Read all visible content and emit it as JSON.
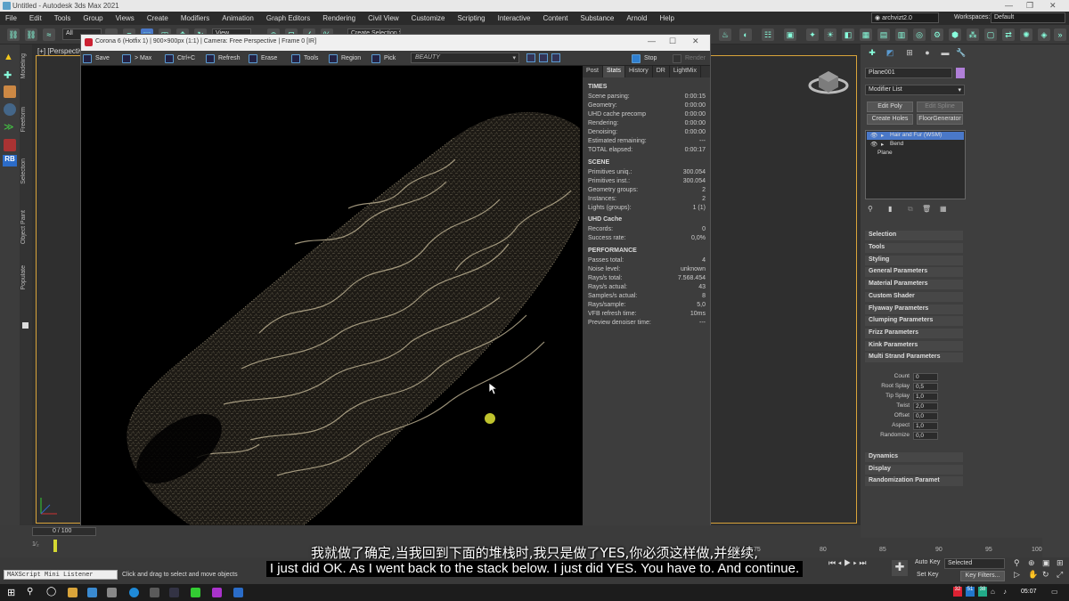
{
  "app": {
    "title": "Untitled - Autodesk 3ds Max 2021"
  },
  "menu": [
    "File",
    "Edit",
    "Tools",
    "Group",
    "Views",
    "Create",
    "Modifiers",
    "Animation",
    "Graph Editors",
    "Rendering",
    "Civil View",
    "Customize",
    "Scripting",
    "Interactive",
    "Content",
    "Substance",
    "Arnold",
    "Help"
  ],
  "account": {
    "user": "archvizt2.0",
    "workspaces_label": "Workspaces:",
    "workspace": "Default"
  },
  "toolbar": {
    "filter": "All",
    "view": "View",
    "selection_set": "Create Selection Se"
  },
  "left_tabs": [
    "Modeling",
    "Freeform",
    "Selection",
    "Object Paint",
    "Populate"
  ],
  "viewport": {
    "label": "[+] [Perspective"
  },
  "vfb": {
    "title": "Corona 6 (Hotfix 1) | 900×900px (1:1) | Camera: Free Perspective | Frame 0 [IR]",
    "tools": [
      "Save",
      "> Max",
      "Ctrl+C",
      "Refresh",
      "Erase",
      "Tools",
      "Region",
      "Pick"
    ],
    "pass": "BEAUTY",
    "stop_label": "Stop",
    "render_label": "Render",
    "tabs": [
      "Post",
      "Stats",
      "History",
      "DR",
      "LightMix"
    ],
    "stats": {
      "times_head": "TIMES",
      "times": [
        {
          "k": "Scene parsing:",
          "v": "0:00:15"
        },
        {
          "k": "Geometry:",
          "v": "0:00:00"
        },
        {
          "k": "UHD cache precomp",
          "v": "0:00:00"
        },
        {
          "k": "Rendering:",
          "v": "0:00:00"
        },
        {
          "k": "Denoising:",
          "v": "0:00:00"
        },
        {
          "k": "Estimated remaining:",
          "v": "---"
        },
        {
          "k": "TOTAL elapsed:",
          "v": "0:00:17"
        }
      ],
      "scene_head": "SCENE",
      "scene": [
        {
          "k": "Primitives uniq.:",
          "v": "300.054"
        },
        {
          "k": "Primitives inst.:",
          "v": "300.054"
        },
        {
          "k": "Geometry groups:",
          "v": "2"
        },
        {
          "k": "Instances:",
          "v": "2"
        },
        {
          "k": "Lights (groups):",
          "v": "1 (1)"
        }
      ],
      "uhd_head": "UHD Cache",
      "uhd": [
        {
          "k": "Records:",
          "v": "0"
        },
        {
          "k": "Success rate:",
          "v": "0,0%"
        }
      ],
      "perf_head": "PERFORMANCE",
      "perf": [
        {
          "k": "Passes total:",
          "v": "4"
        },
        {
          "k": "Noise level:",
          "v": "unknown"
        },
        {
          "k": "Rays/s total:",
          "v": "7.568.454"
        },
        {
          "k": "Rays/s actual:",
          "v": "43"
        },
        {
          "k": "Samples/s actual:",
          "v": "8"
        },
        {
          "k": "Rays/sample:",
          "v": "5,0"
        },
        {
          "k": "VFB refresh time:",
          "v": "10ms"
        },
        {
          "k": "Preview denoiser time:",
          "v": "---"
        }
      ]
    }
  },
  "command_panel": {
    "object_name": "Plane001",
    "modifier_list": "Modifier List",
    "buttons": [
      "Edit Poly",
      "Edit Spline",
      "Create Holes",
      "FloorGenerator"
    ],
    "stack": [
      "Hair and Fur (WSM)",
      "Bend",
      "Plane"
    ],
    "rollouts": [
      "Selection",
      "Tools",
      "Styling",
      "General Parameters",
      "Material Parameters",
      "Custom Shader",
      "Flyaway Parameters",
      "Clumping Parameters",
      "Frizz Parameters",
      "Kink Parameters",
      "Multi Strand Parameters"
    ],
    "multi_strand": [
      {
        "k": "Count",
        "v": "0"
      },
      {
        "k": "Root Splay",
        "v": "0,5"
      },
      {
        "k": "Tip Splay",
        "v": "1,0"
      },
      {
        "k": "Twist",
        "v": "2,0"
      },
      {
        "k": "Offset",
        "v": "0,0"
      },
      {
        "k": "Aspect",
        "v": "1,0"
      },
      {
        "k": "Randomize",
        "v": "0,0"
      }
    ],
    "rollouts_bottom": [
      "Dynamics",
      "Display",
      "Randomization Paramet"
    ]
  },
  "timeline": {
    "frame": "0 / 100",
    "ticks": [
      "75",
      "80",
      "85",
      "90",
      "95",
      "100"
    ]
  },
  "bottom": {
    "listener": "MAXScript Mini Listener",
    "status": "Click and drag to select and move objects",
    "auto_key": "Auto Key",
    "set_key": "Set Key",
    "selected": "Selected",
    "key_filters": "Key Filters..."
  },
  "subtitles": {
    "zh": "我就做了确定,当我回到下面的堆栈时,我只是做了YES,你必须这样做,并继续,",
    "en": "I just did OK. As I went back to the stack below. I just did YES. You have to. And continue."
  },
  "taskbar": {
    "time": "05:07",
    "badge1": "32",
    "badge2": "51",
    "badge3": "38"
  },
  "colors": {
    "accent": "#5a9ad0",
    "selection": "#4a78c8",
    "viewport_border": "#d9a43a",
    "fur": "#c8b58a"
  }
}
